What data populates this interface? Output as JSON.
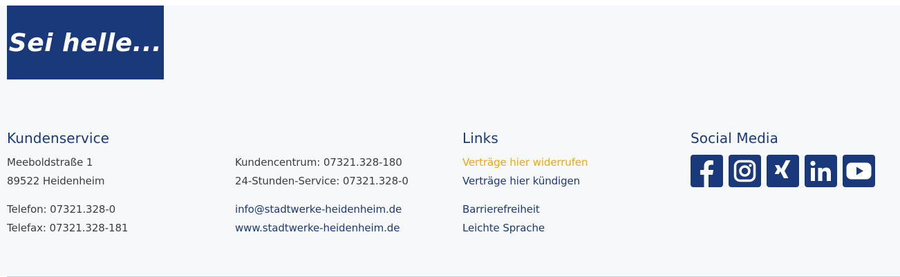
{
  "brand": {
    "slogan": "Sei helle..."
  },
  "kundenservice": {
    "heading": "Kundenservice",
    "street": "Meeboldstraße 1",
    "city": "89522 Heidenheim",
    "phone": "Telefon: 07321.328-0",
    "fax": "Telefax: 07321.328-181",
    "center": "Kundencentrum: 07321.328-180",
    "service24": "24-Stunden-Service: 07321.328-0",
    "email": "info@stadtwerke-heidenheim.de",
    "website": "www.stadtwerke-heidenheim.de"
  },
  "links": {
    "heading": "Links",
    "items": [
      "Verträge hier widerrufen",
      "Verträge hier kündigen",
      "Barrierefreiheit",
      "Leichte Sprache"
    ]
  },
  "social": {
    "heading": "Social Media",
    "icons": [
      "facebook-icon",
      "instagram-icon",
      "xing-icon",
      "linkedin-icon",
      "youtube-icon"
    ]
  },
  "colors": {
    "brand_blue": "#1a397a",
    "highlight": "#f2a900",
    "background": "#f6f8fa",
    "text": "#3c3c3c"
  }
}
